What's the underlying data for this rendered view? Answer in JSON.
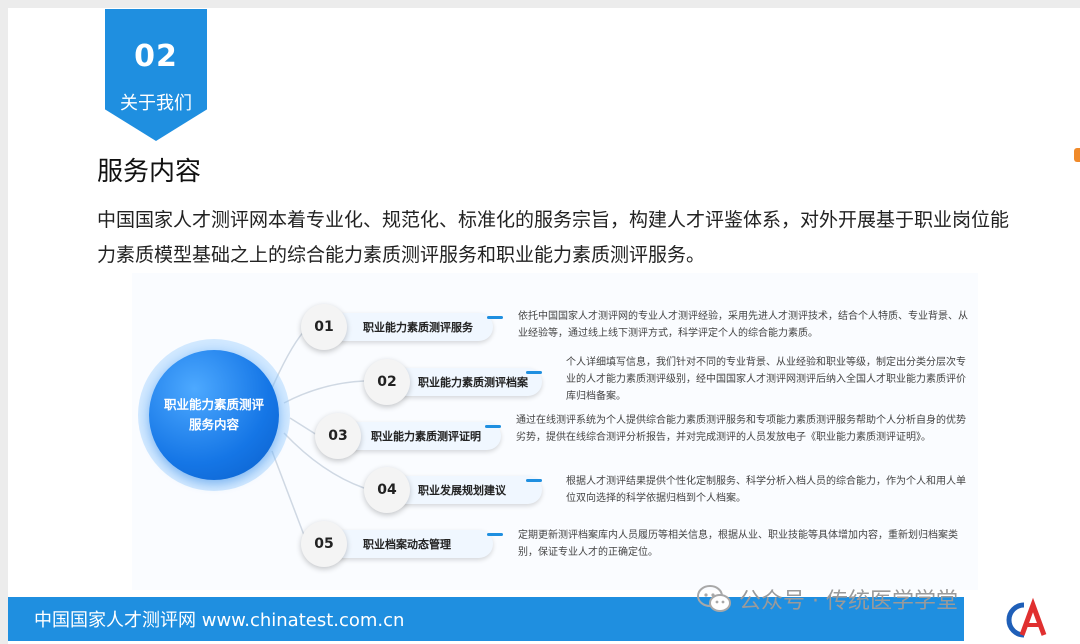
{
  "section": {
    "number": "02",
    "label": "关于我们"
  },
  "title": "服务内容",
  "intro": "中国国家人才测评网本着专业化、规范化、标准化的服务宗旨，构建人才评鉴体系，对外开展基于职业岗位能力素质模型基础之上的综合能力素质测评服务和职业能力素质测评服务。",
  "diagram": {
    "hub": {
      "line1": "职业能力素质测评",
      "line2": "服务内容"
    },
    "items": [
      {
        "num": "01",
        "label": "职业能力素质测评服务",
        "desc": "依托中国国家人才测评网的专业人才测评经验，采用先进人才测评技术，结合个人特质、专业背景、从业经验等，通过线上线下测评方式，科学评定个人的综合能力素质。"
      },
      {
        "num": "02",
        "label": "职业能力素质测评档案",
        "desc": "个人详细填写信息，我们针对不同的专业背景、从业经验和职业等级，制定出分类分层次专业的人才能力素质测评级别，经中国国家人才测评网测评后纳入全国人才职业能力素质评价库归档备案。"
      },
      {
        "num": "03",
        "label": "职业能力素质测评证明",
        "desc": "通过在线测评系统为个人提供综合能力素质测评服务和专项能力素质测评服务帮助个人分析自身的优势劣势，提供在线综合测评分析报告，并对完成测评的人员发放电子《职业能力素质测评证明》。"
      },
      {
        "num": "04",
        "label": "职业发展规划建议",
        "desc": "根据人才测评结果提供个性化定制服务、科学分析入档人员的综合能力，作为个人和用人单位双向选择的科学依据归档到个人档案。"
      },
      {
        "num": "05",
        "label": "职业档案动态管理",
        "desc": "定期更新测评档案库内人员履历等相关信息，根据从业、职业技能等具体增加内容，重新划归档案类别，保证专业人才的正确定位。"
      }
    ]
  },
  "footer": {
    "text": "中国国家人才测评网 www.chinatest.com.cn"
  },
  "watermark": {
    "text": "公众号 · 传统医学学堂"
  },
  "logo": {
    "text": "CA"
  },
  "colors": {
    "accent": "#1f8fe0",
    "hub": "#1576e6",
    "edge_mark": "#f08a2a"
  }
}
